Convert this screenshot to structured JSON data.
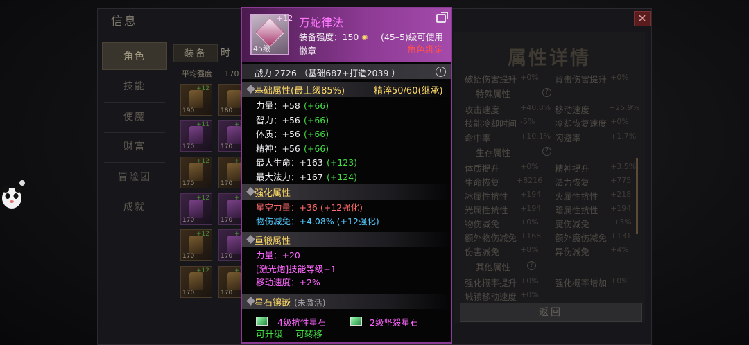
{
  "window": {
    "title": "信息",
    "close_icon": "✕"
  },
  "left_nav": [
    "角色",
    "技能",
    "使魔",
    "财富",
    "冒险团",
    "成就"
  ],
  "subtabs": {
    "equip": "装备",
    "time": "时"
  },
  "avg_strength": {
    "label": "平均强度",
    "value": "170"
  },
  "slots": [
    {
      "plus": "+12",
      "level": "190"
    },
    {
      "plus": "",
      "level": "180"
    },
    {
      "plus": "+11",
      "level": "170"
    },
    {
      "plus": "+12",
      "level": "170"
    },
    {
      "plus": "+12",
      "level": "170"
    },
    {
      "plus": "+12",
      "level": "170"
    },
    {
      "plus": "+12",
      "level": "170"
    },
    {
      "plus": "+12",
      "level": "170"
    },
    {
      "plus": "+12",
      "level": "170"
    },
    {
      "plus": "+12",
      "level": "170"
    },
    {
      "plus": "+12",
      "level": "170"
    },
    {
      "plus": "+12",
      "level": "170"
    }
  ],
  "panel": {
    "title": "属性详情",
    "back_label": "返回",
    "top_rows": [
      [
        "破招伤害提升",
        "+0%",
        "背击伤害提升",
        "+0%"
      ]
    ],
    "sections": [
      {
        "title": "特殊属性",
        "rows": [
          [
            "攻击速度",
            "+40.8%",
            "移动速度",
            "+25.9%"
          ],
          [
            "技能冷却时间",
            "-5%",
            "冷却恢复速度",
            "+0%"
          ],
          [
            "命中率",
            "+10.1%",
            "闪避率",
            "+1.7%"
          ]
        ]
      },
      {
        "title": "生存属性",
        "rows": [
          [
            "体质提升",
            "+0%",
            "精神提升",
            "+3.5%"
          ],
          [
            "生命恢复",
            "+8216",
            "法力恢复",
            "+775"
          ],
          [
            "冰属性抗性",
            "+194",
            "火属性抗性",
            "+218"
          ],
          [
            "光属性抗性",
            "+194",
            "暗属性抗性",
            "+194"
          ],
          [
            "物伤减免",
            "+0%",
            "魔伤减免",
            "+3%"
          ],
          [
            "额外物伤减免",
            "+168",
            "额外魔伤减免",
            "+131"
          ],
          [
            "伤害减免",
            "+8%",
            "异伤减免",
            "+4%"
          ]
        ]
      },
      {
        "title": "其他属性",
        "rows": [
          [
            "强化概率提升",
            "+0%",
            "强化概率增加",
            "+0%"
          ],
          [
            "城镇移动速度",
            "+0%",
            "",
            ""
          ]
        ]
      }
    ]
  },
  "tooltip": {
    "name": "万蛇律法",
    "enhance_plus": "+12",
    "icon_level": "45级",
    "equip_strength_label": "装备强度：",
    "equip_strength_value": "150",
    "usable_level": "(45–5)级可使用",
    "type": "徽章",
    "bind": "角色绑定",
    "power": "战力 2726 （基础687+打造2039 ）",
    "base_section": {
      "title": "基础属性(最上级85%)",
      "right": "精淬50/60(继承)"
    },
    "base_attrs": [
      {
        "label": "力量：+58",
        "bonus": "(+66)"
      },
      {
        "label": "智力：+56",
        "bonus": "(+66)"
      },
      {
        "label": "体质：+56",
        "bonus": "(+66)"
      },
      {
        "label": "精神：+56",
        "bonus": "(+66)"
      },
      {
        "label": "最大生命：+163",
        "bonus": "(+123)"
      },
      {
        "label": "最大法力：+167",
        "bonus": "(+124)"
      }
    ],
    "enhance_section": {
      "title": "强化属性"
    },
    "enhance_attrs": [
      "星空力量：+36 (+12强化)",
      "物伤减免：+4.08% (+12强化)"
    ],
    "forge_section": {
      "title": "重锻属性"
    },
    "forge_attrs": [
      "力量：+20",
      "[激光炮]技能等级+1",
      "移动速度：+2%"
    ],
    "gem_section": {
      "title": "星石镶嵌",
      "status": "(未激活)"
    },
    "gems": [
      "4级抗性星石",
      "2级坚毅星石"
    ],
    "gem_actions": [
      "可升级",
      "可转移"
    ]
  },
  "colors": {
    "tooltip_border": "#8c3a93",
    "title_pink": "#ff78ff",
    "bind_red": "#ff5050",
    "bonus_green": "#44dd44",
    "section_gold": "#ffd966"
  }
}
